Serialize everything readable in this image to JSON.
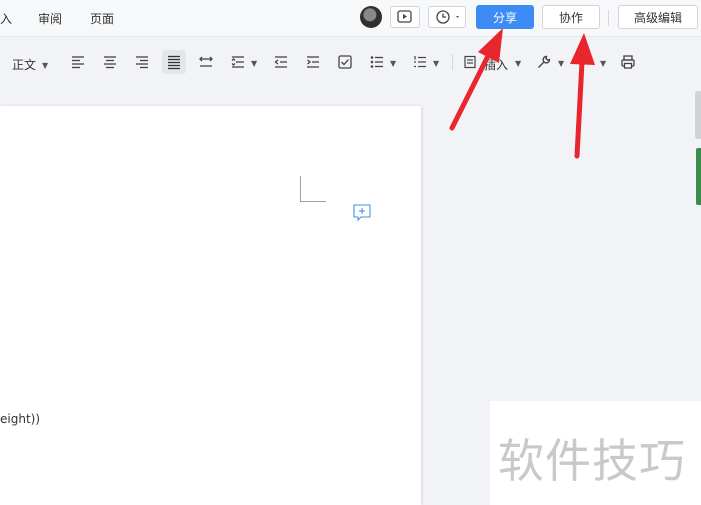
{
  "menu": {
    "insert_partial": "入",
    "review": "审阅",
    "page": "页面"
  },
  "header": {
    "share_label": "分享",
    "collaborate_label": "协作",
    "advanced_edit_label": "高级编辑"
  },
  "toolbar": {
    "paragraph_style": "正文",
    "insert_partial": "插入"
  },
  "document": {
    "visible_text": "eight))"
  },
  "watermark": {
    "text": "软件技巧"
  },
  "colors": {
    "accent": "#3d8cf5",
    "annotation_arrow": "#e8262d",
    "side_tab": "#3a8c4c"
  },
  "icons": [
    "avatar",
    "screen-record-icon",
    "history-clock-icon",
    "align-left-icon",
    "align-center-icon",
    "align-right-icon",
    "justify-icon",
    "line-spacing-icon",
    "paragraph-spacing-icon",
    "outdent-icon",
    "indent-icon",
    "checkbox-icon",
    "bullet-list-icon",
    "numbered-list-icon",
    "insert-icon",
    "tools-wrench-icon",
    "print-icon",
    "add-comment-icon"
  ]
}
